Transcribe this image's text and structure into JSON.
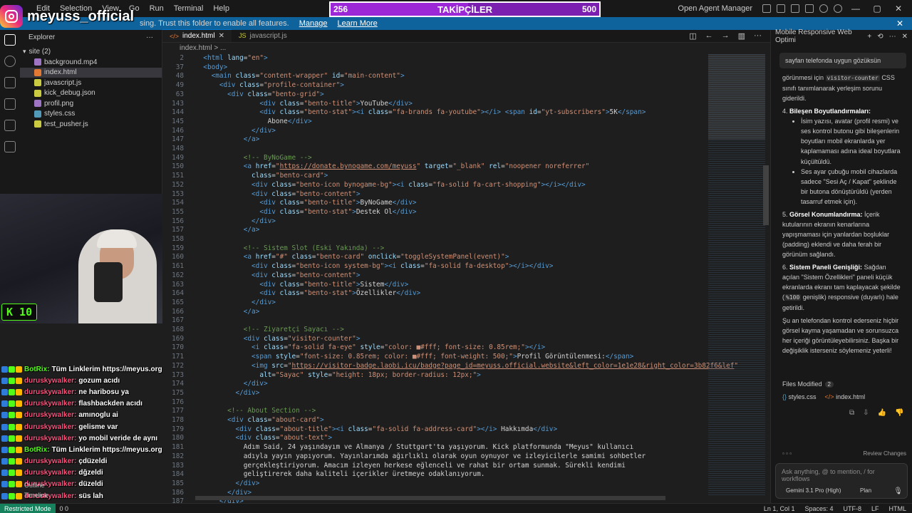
{
  "titlebar": {
    "menu": [
      "Edit",
      "Selection",
      "View",
      "Go",
      "Run",
      "Terminal",
      "Help"
    ],
    "agent_manager": "Open Agent Manager"
  },
  "followers": {
    "current": "256",
    "label": "TAKİPÇİLER",
    "goal": "500",
    "progress": 0.512
  },
  "streamer": {
    "handle": "meyuss_official"
  },
  "banner": {
    "text": "sing. Trust this folder to enable all features.",
    "manage": "Manage",
    "learn_more": "Learn More"
  },
  "sidebar": {
    "title": "Explorer",
    "folder": "site (2)",
    "files": [
      {
        "name": "background.mp4",
        "color": "#a074c4"
      },
      {
        "name": "index.html",
        "color": "#e37933"
      },
      {
        "name": "javascript.js",
        "color": "#cbcb41"
      },
      {
        "name": "kick_debug.json",
        "color": "#cbcb41"
      },
      {
        "name": "profil.png",
        "color": "#a074c4"
      },
      {
        "name": "styles.css",
        "color": "#519aba"
      },
      {
        "name": "test_pusher.js",
        "color": "#cbcb41"
      }
    ],
    "selected_index": 1
  },
  "webcam": {
    "counter": "K 10"
  },
  "chat": [
    {
      "user": "BotRix:",
      "msg": "Tüm Linklerim https://meyus.org",
      "color": "#53fc18"
    },
    {
      "user": "duruskywalker:",
      "msg": "gozum acıdı",
      "color": "#ff4f7b"
    },
    {
      "user": "duruskywalker:",
      "msg": "ne haribosu ya",
      "color": "#ff4f7b"
    },
    {
      "user": "duruskywalker:",
      "msg": "flashbackden acıdı",
      "color": "#ff4f7b"
    },
    {
      "user": "duruskywalker:",
      "msg": "amınoglu ai",
      "color": "#ff4f7b"
    },
    {
      "user": "duruskywalker:",
      "msg": "gelisme var",
      "color": "#ff4f7b"
    },
    {
      "user": "duruskywalker:",
      "msg": "yo mobil veride de aynı",
      "color": "#ff4f7b"
    },
    {
      "user": "BotRix:",
      "msg": "Tüm Linklerim https://meyus.org",
      "color": "#53fc18"
    },
    {
      "user": "duruskywalker:",
      "msg": "çdüzeldi",
      "color": "#ff4f7b"
    },
    {
      "user": "duruskywalker:",
      "msg": "dğzeldi",
      "color": "#ff4f7b"
    },
    {
      "user": "duruskywalker:",
      "msg": "düzeldi",
      "color": "#ff4f7b"
    },
    {
      "user": "duruskywalker:",
      "msg": "süs lah",
      "color": "#ff4f7b"
    }
  ],
  "outline": [
    "Outline",
    "Timeline"
  ],
  "editor": {
    "tabs": [
      {
        "name": "index.html",
        "active": true
      },
      {
        "name": "javascript.js",
        "active": false
      }
    ],
    "breadcrumb": "index.html > ...",
    "lines": [
      {
        "n": "2",
        "html": "  <span class='tag'>&lt;html</span> <span class='attr'>lang</span>=<span class='str'>\"en\"</span><span class='tag'>&gt;</span>"
      },
      {
        "n": "37",
        "html": "  <span class='tag'>&lt;body&gt;</span>"
      },
      {
        "n": "48",
        "html": "    <span class='tag'>&lt;main</span> <span class='attr'>class</span>=<span class='str'>\"content-wrapper\"</span> <span class='attr'>id</span>=<span class='str'>\"main-content\"</span><span class='tag'>&gt;</span>"
      },
      {
        "n": "49",
        "html": "      <span class='tag'>&lt;div</span> <span class='attr'>class</span>=<span class='str'>\"profile-container\"</span><span class='tag'>&gt;</span>"
      },
      {
        "n": "63",
        "html": "        <span class='tag'>&lt;div</span> <span class='attr'>class</span>=<span class='str'>\"bento-grid\"</span><span class='tag'>&gt;</span>"
      },
      {
        "n": "143",
        "html": "                <span class='tag'>&lt;div</span> <span class='attr'>class</span>=<span class='str'>\"bento-title\"</span><span class='tag'>&gt;</span>YouTube<span class='tag'>&lt;/div&gt;</span>"
      },
      {
        "n": "144",
        "html": "                <span class='tag'>&lt;div</span> <span class='attr'>class</span>=<span class='str'>\"bento-stat\"</span><span class='tag'>&gt;&lt;i</span> <span class='attr'>class</span>=<span class='str'>\"fa-brands fa-youtube\"</span><span class='tag'>&gt;&lt;/i&gt;</span> <span class='tag'>&lt;span</span> <span class='attr'>id</span>=<span class='str'>\"yt-subscribers\"</span><span class='tag'>&gt;</span>5K<span class='tag'>&lt;/span&gt;</span>"
      },
      {
        "n": "145",
        "html": "                  Abone<span class='tag'>&lt;/div&gt;</span>"
      },
      {
        "n": "146",
        "html": "              <span class='tag'>&lt;/div&gt;</span>"
      },
      {
        "n": "147",
        "html": "            <span class='tag'>&lt;/a&gt;</span>"
      },
      {
        "n": "148",
        "html": ""
      },
      {
        "n": "149",
        "html": "            <span class='com'>&lt;!-- ByNoGame --&gt;</span>"
      },
      {
        "n": "150",
        "html": "            <span class='tag'>&lt;a</span> <span class='attr'>href</span>=<span class='str'>\"<u>https://donate.bynogame.com/meyuss</u>\"</span> <span class='attr'>target</span>=<span class='str'>\"_blank\"</span> <span class='attr'>rel</span>=<span class='str'>\"noopener noreferrer\"</span>"
      },
      {
        "n": "151",
        "html": "              <span class='attr'>class</span>=<span class='str'>\"bento-card\"</span><span class='tag'>&gt;</span>"
      },
      {
        "n": "152",
        "html": "              <span class='tag'>&lt;div</span> <span class='attr'>class</span>=<span class='str'>\"bento-icon bynogame-bg\"</span><span class='tag'>&gt;&lt;i</span> <span class='attr'>class</span>=<span class='str'>\"fa-solid fa-cart-shopping\"</span><span class='tag'>&gt;&lt;/i&gt;&lt;/div&gt;</span>"
      },
      {
        "n": "153",
        "html": "              <span class='tag'>&lt;div</span> <span class='attr'>class</span>=<span class='str'>\"bento-content\"</span><span class='tag'>&gt;</span>"
      },
      {
        "n": "154",
        "html": "                <span class='tag'>&lt;div</span> <span class='attr'>class</span>=<span class='str'>\"bento-title\"</span><span class='tag'>&gt;</span>ByNoGame<span class='tag'>&lt;/div&gt;</span>"
      },
      {
        "n": "155",
        "html": "                <span class='tag'>&lt;div</span> <span class='attr'>class</span>=<span class='str'>\"bento-stat\"</span><span class='tag'>&gt;</span>Destek Ol<span class='tag'>&lt;/div&gt;</span>"
      },
      {
        "n": "156",
        "html": "              <span class='tag'>&lt;/div&gt;</span>"
      },
      {
        "n": "157",
        "html": "            <span class='tag'>&lt;/a&gt;</span>"
      },
      {
        "n": "158",
        "html": ""
      },
      {
        "n": "159",
        "html": "            <span class='com'>&lt;!-- Sistem Slot (Eski Yakında) --&gt;</span>"
      },
      {
        "n": "160",
        "html": "            <span class='tag'>&lt;a</span> <span class='attr'>href</span>=<span class='str'>\"#\"</span> <span class='attr'>class</span>=<span class='str'>\"bento-card\"</span> <span class='attr'>onclick</span>=<span class='str'>\"toggleSystemPanel(event)\"</span><span class='tag'>&gt;</span>"
      },
      {
        "n": "161",
        "html": "              <span class='tag'>&lt;div</span> <span class='attr'>class</span>=<span class='str'>\"bento-icon system-bg\"</span><span class='tag'>&gt;&lt;i</span> <span class='attr'>class</span>=<span class='str'>\"fa-solid fa-desktop\"</span><span class='tag'>&gt;&lt;/i&gt;&lt;/div&gt;</span>"
      },
      {
        "n": "162",
        "html": "              <span class='tag'>&lt;div</span> <span class='attr'>class</span>=<span class='str'>\"bento-content\"</span><span class='tag'>&gt;</span>"
      },
      {
        "n": "163",
        "html": "                <span class='tag'>&lt;div</span> <span class='attr'>class</span>=<span class='str'>\"bento-title\"</span><span class='tag'>&gt;</span>Sistem<span class='tag'>&lt;/div&gt;</span>"
      },
      {
        "n": "164",
        "html": "                <span class='tag'>&lt;div</span> <span class='attr'>class</span>=<span class='str'>\"bento-stat\"</span><span class='tag'>&gt;</span>Özellikler<span class='tag'>&lt;/div&gt;</span>"
      },
      {
        "n": "165",
        "html": "              <span class='tag'>&lt;/div&gt;</span>"
      },
      {
        "n": "166",
        "html": "            <span class='tag'>&lt;/a&gt;</span>"
      },
      {
        "n": "167",
        "html": ""
      },
      {
        "n": "168",
        "html": "            <span class='com'>&lt;!-- Ziyaretçi Sayacı --&gt;</span>"
      },
      {
        "n": "169",
        "html": "            <span class='tag'>&lt;div</span> <span class='attr'>class</span>=<span class='str'>\"visitor-counter\"</span><span class='tag'>&gt;</span>"
      },
      {
        "n": "170",
        "html": "              <span class='tag'>&lt;i</span> <span class='attr'>class</span>=<span class='str'>\"fa-solid fa-eye\"</span> <span class='attr'>style</span>=<span class='str'>\"color: ■#fff; font-size: 0.85rem;\"</span><span class='tag'>&gt;&lt;/i&gt;</span>"
      },
      {
        "n": "171",
        "html": "              <span class='tag'>&lt;span</span> <span class='attr'>style</span>=<span class='str'>\"font-size: 0.85rem; color: ■#fff; font-weight: 500;\"</span><span class='tag'>&gt;</span>Profil Görüntülenmesi:<span class='tag'>&lt;/span&gt;</span>"
      },
      {
        "n": "172",
        "html": "              <span class='tag'>&lt;img</span> <span class='attr'>src</span>=<span class='str'>\"<u>https://visitor-badge.laobi.icu/badge?page_id=meyuss.official.website&amp;left_color=1e1e28&amp;right_color=3b82f6&amp;lef</u>\"</span>"
      },
      {
        "n": "173",
        "html": "                <span class='attr'>alt</span>=<span class='str'>\"Sayac\"</span> <span class='attr'>style</span>=<span class='str'>\"height: 18px; border-radius: 12px;\"</span><span class='tag'>&gt;</span>"
      },
      {
        "n": "174",
        "html": "            <span class='tag'>&lt;/div&gt;</span>"
      },
      {
        "n": "175",
        "html": "          <span class='tag'>&lt;/div&gt;</span>"
      },
      {
        "n": "176",
        "html": ""
      },
      {
        "n": "177",
        "html": "        <span class='com'>&lt;!-- About Section --&gt;</span>"
      },
      {
        "n": "178",
        "html": "        <span class='tag'>&lt;div</span> <span class='attr'>class</span>=<span class='str'>\"about-card\"</span><span class='tag'>&gt;</span>"
      },
      {
        "n": "179",
        "html": "          <span class='tag'>&lt;div</span> <span class='attr'>class</span>=<span class='str'>\"about-title\"</span><span class='tag'>&gt;&lt;i</span> <span class='attr'>class</span>=<span class='str'>\"fa-solid fa-address-card\"</span><span class='tag'>&gt;&lt;/i&gt;</span> Hakkımda<span class='tag'>&lt;/div&gt;</span>"
      },
      {
        "n": "180",
        "html": "          <span class='tag'>&lt;div</span> <span class='attr'>class</span>=<span class='str'>\"about-text\"</span><span class='tag'>&gt;</span>"
      },
      {
        "n": "181",
        "html": "            Adım Said, 24 yaşındayım ve Almanya / Stuttgart'ta yaşıyorum. Kick platformunda \"Meyus\" kullanıcı"
      },
      {
        "n": "182",
        "html": "            adıyla yayın yapıyorum. Yayınlarımda ağırlıklı olarak oyun oynuyor ve izleyicilerle samimi sohbetler"
      },
      {
        "n": "183",
        "html": "            gerçekleştiriyorum. Amacım izleyen herkese eğlenceli ve rahat bir ortam sunmak. Sürekli kendimi"
      },
      {
        "n": "184",
        "html": "            geliştirerek daha kaliteli içerikler üretmeye odaklanıyorum."
      },
      {
        "n": "185",
        "html": "          <span class='tag'>&lt;/div&gt;</span>"
      },
      {
        "n": "186",
        "html": "        <span class='tag'>&lt;/div&gt;</span>"
      },
      {
        "n": "187",
        "html": "      <span class='tag'>&lt;/div&gt;</span>"
      }
    ]
  },
  "panel": {
    "title": "Mobile Responsive Web Optimi",
    "user_message": "sayfan telefonda uygun gözüksün",
    "resp_intro": "görünmesi için",
    "resp_code": "visitor-counter",
    "resp_intro_tail": "CSS sınıfı tanımlanarak yerleşim sorunu giderildi.",
    "item4_title": "Bileşen Boyutlandırmaları:",
    "bullets": [
      "İsim yazısı, avatar (profil resmi) ve ses kontrol butonu gibi bileşenlerin boyutları mobil ekranlarda yer kaplamaması adına ideal boyutlara küçültüldü.",
      "Ses ayar çubuğu mobil cihazlarda sadece \"Sesi Aç / Kapat\" şeklinde bir butona dönüştürüldü (yerden tasarruf etmek için)."
    ],
    "item5_title": "Görsel Konumlandırma:",
    "item5_text": "İçerik kutularının ekranın kenarlarına yapışmaması için yanlardan boşluklar (padding) eklendi ve daha ferah bir görünüm sağlandı.",
    "item6_title": "Sistem Paneli Genişliği:",
    "item6_text_a": "Sağdan açılan \"Sistem Özellikleri\" paneli küçük ekranlarda ekranı tam kaplayacak şekilde (",
    "item6_code": "%100",
    "item6_text_b": "genişlik) responsive (duyarlı) hale getirildi.",
    "closing": "Şu an telefondan kontrol ederseniz hiçbir görsel kayma yaşamadan ve sorunsuzca her içeriği görüntüleyebilirsiniz. Başka bir değişiklik isterseniz söylemeniz yeterli!",
    "files_modified": "Files Modified",
    "files_count": "2",
    "files": [
      "styles.css",
      "index.html"
    ],
    "review": "Review Changes",
    "input_placeholder": "Ask anything, @ to mention, / for workflows",
    "model": "Gemini 3.1 Pro (High)",
    "mode": "Plan"
  },
  "statusbar": {
    "remote": "Restricted Mode",
    "errors": "0  0",
    "position": "Ln 1, Col 1",
    "spaces": "Spaces: 4",
    "encoding": "UTF-8",
    "eol": "LF",
    "language": "HTML"
  }
}
